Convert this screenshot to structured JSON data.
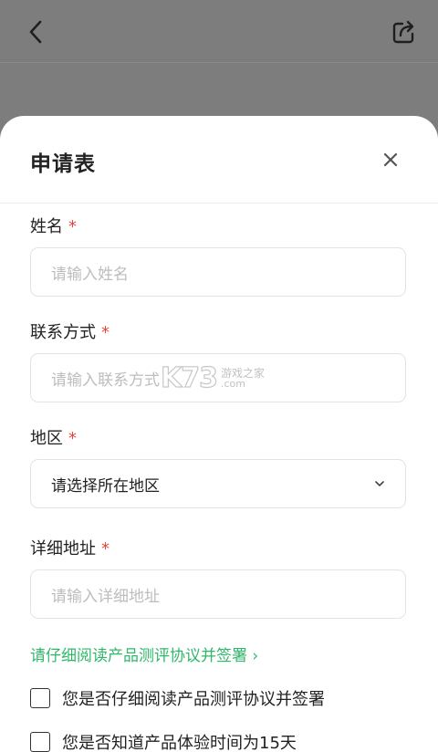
{
  "header": {
    "back_icon": "chevron-left-icon",
    "share_icon": "share-icon"
  },
  "sheet": {
    "title": "申请表",
    "close_icon": "close-icon"
  },
  "form": {
    "name": {
      "label": "姓名",
      "required_mark": "*",
      "placeholder": "请输入姓名"
    },
    "contact": {
      "label": "联系方式",
      "required_mark": "*",
      "placeholder": "请输入联系方式"
    },
    "region": {
      "label": "地区",
      "required_mark": "*",
      "value": "请选择所在地区",
      "icon": "chevron-down-icon"
    },
    "address": {
      "label": "详细地址",
      "required_mark": "*",
      "placeholder": "请输入详细地址"
    }
  },
  "agreement": {
    "link_text": "请仔细阅读产品测评协议并签署 ›"
  },
  "checks": [
    {
      "text": "您是否仔细阅读产品测评协议并签署",
      "checked": false
    },
    {
      "text": "您是否知道产品体验时间为15天",
      "checked": false
    }
  ],
  "watermark": {
    "logo": "K73",
    "cn": "游戏之家",
    "domain": ".com"
  },
  "colors": {
    "overlay": "#7d7d7d",
    "required": "#e8443b",
    "link": "#2fb86a",
    "placeholder": "#bdbdbd"
  }
}
